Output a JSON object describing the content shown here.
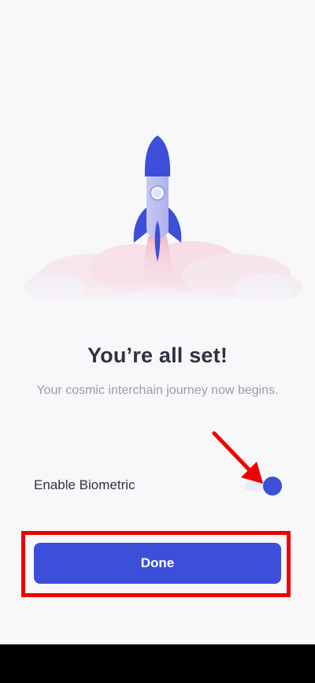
{
  "onboarding": {
    "title": "You’re all set!",
    "subtitle": "Your cosmic interchain journey now begins.",
    "biometric_label": "Enable Biometric",
    "biometric_enabled": true,
    "done_label": "Done"
  },
  "illustration": {
    "icon": "rocket-icon"
  },
  "colors": {
    "accent": "#3c4fd8",
    "highlight": "#ee0000",
    "title": "#2f3340",
    "subtitle": "#9a9ca6",
    "background": "#f8f8fb"
  }
}
